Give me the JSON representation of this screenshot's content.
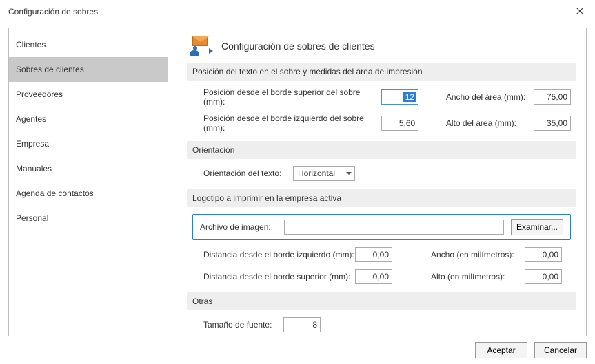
{
  "window": {
    "title": "Configuración de sobres"
  },
  "sidebar": {
    "items": [
      {
        "label": "Clientes"
      },
      {
        "label": "Sobres de clientes",
        "selected": true
      },
      {
        "label": "Proveedores"
      },
      {
        "label": "Agentes"
      },
      {
        "label": "Empresa"
      },
      {
        "label": "Manuales"
      },
      {
        "label": "Agenda de contactos"
      },
      {
        "label": "Personal"
      }
    ]
  },
  "main": {
    "title": "Configuración de sobres de clientes",
    "sections": {
      "position": {
        "header": "Posición del texto en el sobre y medidas del área de impresión",
        "pos_top_label": "Posición desde el borde superior del sobre (mm):",
        "pos_top_value": "12",
        "pos_left_label": "Posición desde el borde izquierdo del sobre (mm):",
        "pos_left_value": "5,60",
        "area_width_label": "Ancho del área (mm):",
        "area_width_value": "75,00",
        "area_height_label": "Alto del área (mm):",
        "area_height_value": "35,00"
      },
      "orientation": {
        "header": "Orientación",
        "label": "Orientación del texto:",
        "value": "Horizontal"
      },
      "logo": {
        "header": "Logotipo a imprimir en la empresa activa",
        "file_label": "Archivo de imagen:",
        "file_value": "",
        "browse_label": "Examinar...",
        "dist_left_label": "Distancia desde el borde izquierdo (mm):",
        "dist_left_value": "0,00",
        "dist_top_label": "Distancia desde el borde superior (mm):",
        "dist_top_value": "0,00",
        "width_label": "Ancho (en milímetros):",
        "width_value": "0,00",
        "height_label": "Alto (en milímetros):",
        "height_value": "0,00"
      },
      "other": {
        "header": "Otras",
        "font_size_label": "Tamaño de fuente:",
        "font_size_value": "8"
      }
    }
  },
  "footer": {
    "accept": "Aceptar",
    "cancel": "Cancelar"
  }
}
